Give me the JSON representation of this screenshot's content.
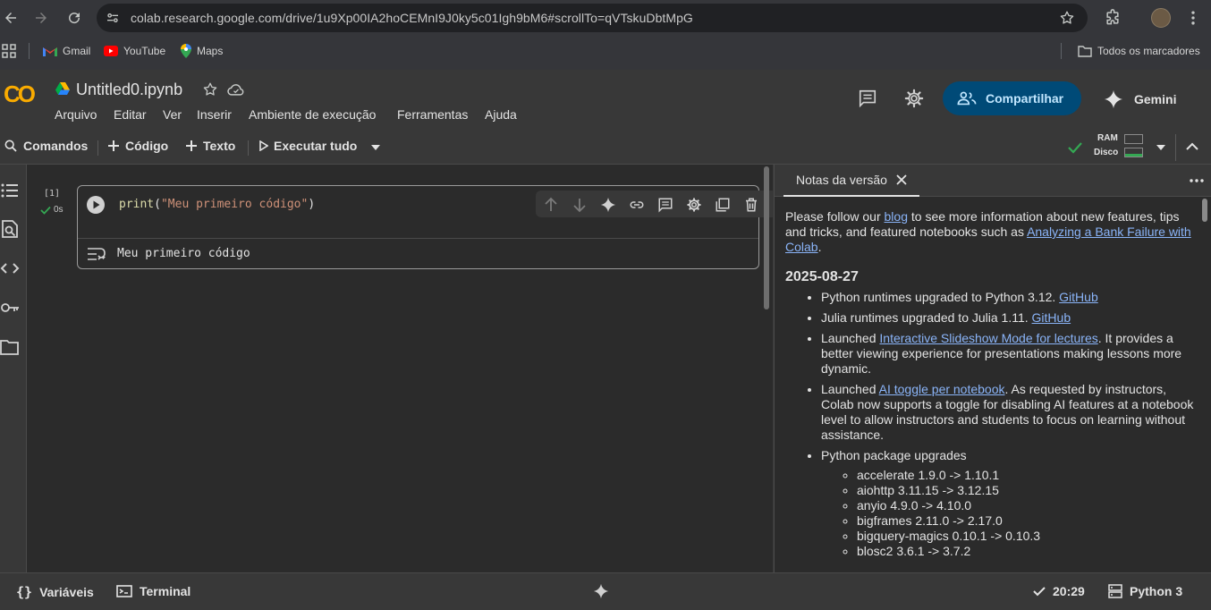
{
  "browser": {
    "url": "colab.research.google.com/drive/1u9Xp00IA2hoCEMnI9J0ky5c01Igh9bM6#scrollTo=qVTskuDbtMpG",
    "bookmarks": [
      {
        "label": "Gmail",
        "icon": "gmail-icon"
      },
      {
        "label": "YouTube",
        "icon": "youtube-icon"
      },
      {
        "label": "Maps",
        "icon": "maps-icon"
      }
    ],
    "all_bookmarks": "Todos os marcadores"
  },
  "colab": {
    "logo": "CO",
    "notebook_title": "Untitled0.ipynb",
    "menu": [
      "Arquivo",
      "Editar",
      "Ver",
      "Inserir",
      "Ambiente de execução",
      "Ferramentas",
      "Ajuda"
    ],
    "share_label": "Compartilhar",
    "gemini_label": "Gemini",
    "accent": "#f9ab00",
    "share_bg": "#004a77"
  },
  "toolbar": {
    "commands": "Comandos",
    "add_code": "Código",
    "add_text": "Texto",
    "run_all": "Executar tudo",
    "ram_label": "RAM",
    "disk_label": "Disco"
  },
  "cell": {
    "exec_count": "[1]",
    "exec_time": "0s",
    "code_fn": "print",
    "code_open": "(",
    "code_string": "\"Meu primeiro código\"",
    "code_close": ")",
    "output": "Meu primeiro código"
  },
  "side_panel": {
    "tab_label": "Notas da versão",
    "intro_1": "Please follow our ",
    "intro_link_1": "blog",
    "intro_2": " to see more information about new features, tips and tricks, and featured notebooks such as ",
    "intro_link_2": "Analyzing a Bank Failure with Colab",
    "intro_3": ".",
    "date": "2025-08-27",
    "items": [
      {
        "text": "Python runtimes upgraded to Python 3.12. ",
        "link": "GitHub",
        "after": ""
      },
      {
        "text": "Julia runtimes upgraded to Julia 1.11. ",
        "link": "GitHub",
        "after": ""
      },
      {
        "text": "Launched ",
        "link": "Interactive Slideshow Mode for lectures",
        "after": ". It provides a better viewing experience for presentations making lessons more dynamic."
      },
      {
        "text": "Launched ",
        "link": "AI toggle per notebook",
        "after": ". As requested by instructors, Colab now supports a toggle for disabling AI features at a notebook level to allow instructors and students to focus on learning without assistance."
      }
    ],
    "packages_label": "Python package upgrades",
    "packages": [
      "accelerate 1.9.0 -> 1.10.1",
      "aiohttp 3.11.15 -> 3.12.15",
      "anyio 4.9.0 -> 4.10.0",
      "bigframes 2.11.0 -> 2.17.0",
      "bigquery-magics 0.10.1 -> 0.10.3",
      "blosc2 3.6.1 -> 3.7.2"
    ]
  },
  "status": {
    "variables": "Variáveis",
    "terminal": "Terminal",
    "time": "20:29",
    "runtime": "Python 3"
  }
}
